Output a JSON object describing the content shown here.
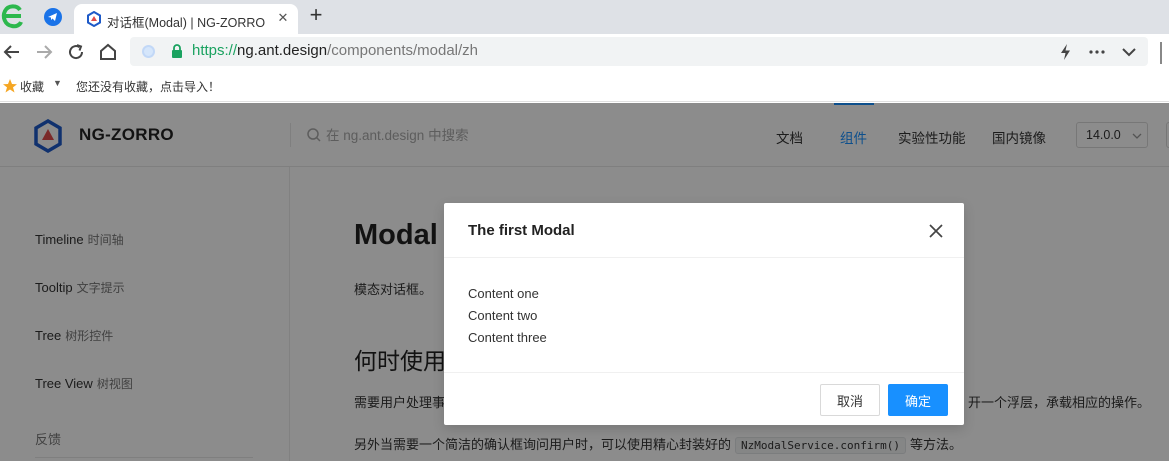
{
  "browser": {
    "tab_title": "对话框(Modal) | NG-ZORRO",
    "tab_close": "✕",
    "new_tab": "+",
    "url_scheme": "https://",
    "url_host": "ng.ant.design",
    "url_path": "/components/modal/zh",
    "bookmarks_label": "收藏",
    "bookmarks_empty": "您还没有收藏，点击导入！"
  },
  "header": {
    "site_name": "NG-ZORRO",
    "search_placeholder": "在 ng.ant.design 中搜索",
    "menu": [
      {
        "label": "文档"
      },
      {
        "label": "组件",
        "active": true
      },
      {
        "label": "实验性功能"
      },
      {
        "label": "国内镜像"
      }
    ],
    "version": "14.0.0"
  },
  "sidebar": {
    "items": [
      {
        "en": "Timeline",
        "cn": "时间轴"
      },
      {
        "en": "Tooltip",
        "cn": "文字提示"
      },
      {
        "en": "Tree",
        "cn": "树形控件"
      },
      {
        "en": "Tree View",
        "cn": "树视图"
      }
    ],
    "feedback": "反馈"
  },
  "content": {
    "title": "Modal",
    "description": "模态对话框。",
    "h2": "何时使用",
    "para1_start": "需要用户处理事",
    "para1_end": "开一个浮层，承载相应的操作。",
    "para2_before": "另外当需要一个简洁的确认框询问用户时，可以使用精心封装好的",
    "para2_code": "NzModalService.confirm()",
    "para2_after": "等方法。"
  },
  "modal": {
    "title": "The first Modal",
    "body": [
      "Content one",
      "Content two",
      "Content three"
    ],
    "cancel_label": "取消",
    "ok_label": "确定"
  },
  "colors": {
    "primary": "#1890ff",
    "mask": "rgba(0,0,0,0.45)",
    "secure_green": "#1aa260"
  },
  "icons": [
    "browser-logo-icon",
    "telegram-icon",
    "ng-zorro-favicon",
    "back-arrow-icon",
    "forward-arrow-icon",
    "reload-icon",
    "home-icon",
    "lock-icon",
    "lightning-icon",
    "more-icon",
    "chevron-down-icon",
    "star-icon",
    "search-icon",
    "close-icon"
  ]
}
